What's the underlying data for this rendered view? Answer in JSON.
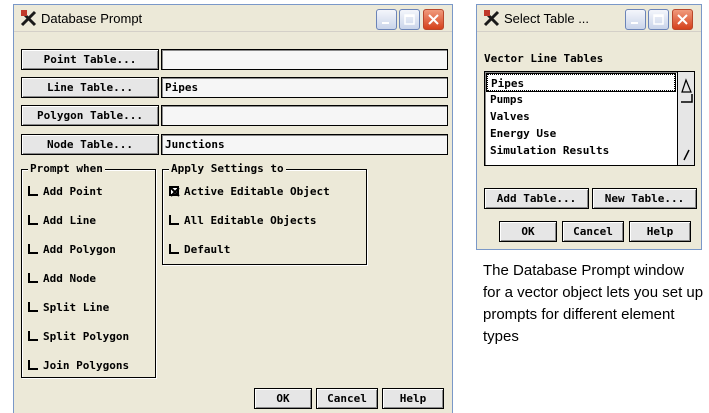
{
  "db_prompt": {
    "title": "Database Prompt",
    "rows": [
      {
        "button": "Point Table...",
        "value": ""
      },
      {
        "button": "Line Table...",
        "value": "Pipes"
      },
      {
        "button": "Polygon Table...",
        "value": ""
      },
      {
        "button": "Node Table...",
        "value": "Junctions"
      }
    ],
    "prompt_when": {
      "title": "Prompt when",
      "options": [
        "Add Point",
        "Add Line",
        "Add Polygon",
        "Add Node",
        "Split Line",
        "Split Polygon",
        "Join Polygons"
      ]
    },
    "apply_settings": {
      "title": "Apply Settings to",
      "options": [
        {
          "label": "Active Editable Object",
          "checked": true
        },
        {
          "label": "All Editable Objects",
          "checked": false
        },
        {
          "label": "Default",
          "checked": false
        }
      ]
    },
    "buttons": {
      "ok": "OK",
      "cancel": "Cancel",
      "help": "Help"
    }
  },
  "select_table": {
    "title": "Select Table ...",
    "list_label": "Vector Line Tables",
    "items": [
      "Pipes",
      "Pumps",
      "Valves",
      "Energy Use",
      "Simulation Results"
    ],
    "selected": "Pipes",
    "add_table": "Add Table...",
    "new_table": "New Table...",
    "ok": "OK",
    "cancel": "Cancel",
    "help": "Help"
  },
  "caption": "The Database Prompt window for a vector object lets you set up prompts for different element types",
  "icons": {
    "app": "tnt-app-icon",
    "minimize": "minimize-icon",
    "maximize": "maximize-icon",
    "close": "close-icon"
  },
  "colors": {
    "window_bg": "#ece9d8",
    "close_red": "#d5411c",
    "title_border": "#7a98c8"
  }
}
